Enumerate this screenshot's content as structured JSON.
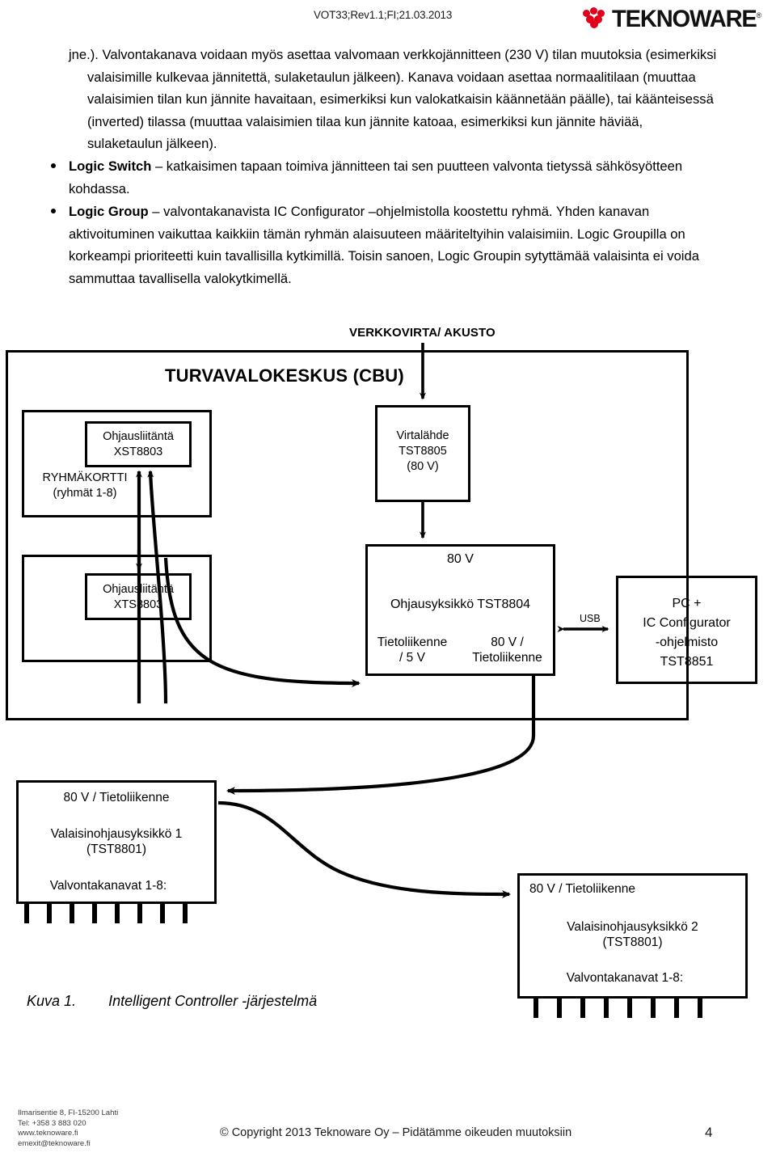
{
  "header": {
    "doc_code": "VOT33;Rev1.1;FI;21.03.2013",
    "logo_text": "TEKNOWARE",
    "logo_registered": "®",
    "logo_color": "#e1001a"
  },
  "prose": {
    "paragraph": "jne.). Valvontakanava voidaan myös asettaa valvomaan verkkojännitteen (230 V) tilan muutoksia (esimerkiksi valaisimille kulkevaa jännitettä, sulaketaulun jälkeen). Kanava voidaan asettaa normaalitilaan (muuttaa valaisimien tilan kun jännite havaitaan, esimerkiksi kun valokatkaisin käännetään päälle), tai käänteisessä (inverted) tilassa (muuttaa valaisimien tilaa kun jännite katoaa, esimerkiksi kun jännite häviää, sulaketaulun jälkeen)."
  },
  "bullets": [
    {
      "term": "Logic Switch",
      "text": " – katkaisimen tapaan toimiva jännitteen tai sen puutteen valvonta tietyssä sähkösyötteen kohdassa."
    },
    {
      "term": "Logic Group",
      "text": " – valvontakanavista IC Configurator –ohjelmistolla koostettu ryhmä. Yhden kanavan aktivoituminen vaikuttaa kaikkiin tämän ryhmän alaisuuteen määriteltyihin valaisimiin. Logic Groupilla on korkeampi prioriteetti kuin tavallisilla kytkimillä. Toisin sanoen, Logic Groupin sytyttämää valaisinta ei voida sammuttaa tavallisella valokytkimellä."
    }
  ],
  "diagram": {
    "mains_label": "VERKKOVIRTA/ AKUSTO",
    "cbu_title": "TURVAVALOKESKUS (CBU)",
    "ryhmakortti_label": "RYHMÄKORTTI\n(ryhmät 1-8)",
    "xst_box": "Ohjausliitäntä\nXST8803",
    "xts_box": "Ohjausliitäntä\nXTS8803",
    "virtalahde_box": "Virtalähde\nTST8805\n(80 V)",
    "ohjausyksikko": {
      "voltage_top": "80 V",
      "title": "Ohjausyksikkö TST8804",
      "left_bottom": "Tietoliikenne\n/ 5 V",
      "right_bottom": "80 V /\nTietoliikenne"
    },
    "usb_label": "USB",
    "pc_box": "PC +\nIC Configurator\n-ohjelmisto\nTST8851",
    "unit1": {
      "top_label": "80 V / Tietoliikenne",
      "title": "Valaisinohjausyksikkö 1\n(TST8801)",
      "channels_label": "Valvontakanavat 1-8:",
      "channel_count": 8
    },
    "unit2": {
      "top_label": "80 V / Tietoliikenne",
      "title": "Valaisinohjausyksikkö 2\n(TST8801)",
      "channels_label": "Valvontakanavat 1-8:",
      "channel_count": 8
    }
  },
  "caption": {
    "number": "Kuva 1.",
    "text": "Intelligent Controller -järjestelmä"
  },
  "footer": {
    "address": "Ilmarisentie 8, FI-15200 Lahti\nTel: +358 3 883 020\nwww.teknoware.fi\nemexit@teknoware.fi",
    "copyright": "© Copyright 2013 Teknoware Oy – Pidätämme oikeuden muutoksiin",
    "page_number": "4"
  }
}
